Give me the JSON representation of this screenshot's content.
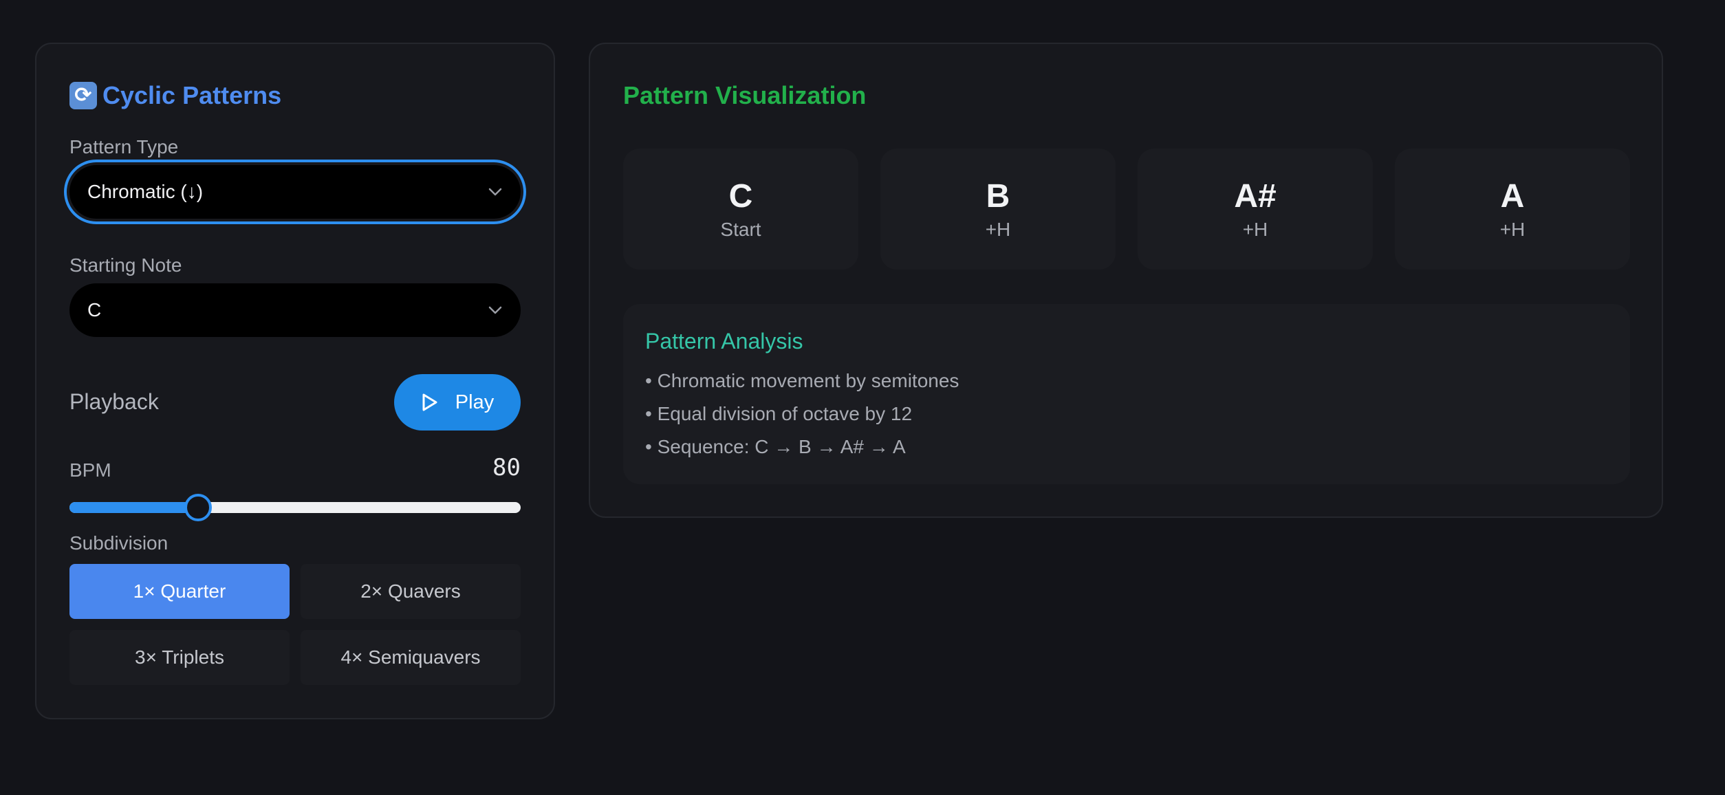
{
  "left": {
    "title": "Cyclic Patterns",
    "title_icon": "refresh-icon",
    "pattern_type": {
      "label": "Pattern Type",
      "value": "Chromatic (↓)"
    },
    "starting_note": {
      "label": "Starting Note",
      "value": "C"
    },
    "playback": {
      "label": "Playback",
      "play_label": "Play",
      "play_icon": "play-icon"
    },
    "bpm": {
      "label": "BPM",
      "value": "80",
      "fill_fraction": 0.285
    },
    "subdivision": {
      "label": "Subdivision",
      "options": [
        "1× Quarter",
        "2× Quavers",
        "3× Triplets",
        "4× Semiquavers"
      ],
      "selected": "1× Quarter"
    }
  },
  "right": {
    "title": "Pattern Visualization",
    "notes": [
      {
        "name": "C",
        "sub": "Start"
      },
      {
        "name": "B",
        "sub": "+H"
      },
      {
        "name": "A#",
        "sub": "+H"
      },
      {
        "name": "A",
        "sub": "+H"
      }
    ],
    "analysis": {
      "title": "Pattern Analysis",
      "lines": [
        "• Chromatic movement by semitones",
        "• Equal division of octave by 12",
        "• Sequence: C → B → A# → A"
      ]
    }
  },
  "colors": {
    "background": "#131419",
    "panel": "#17181d",
    "accent_blue": "#2d8ff0",
    "title_blue": "#4f8cf0",
    "title_green": "#22b04b",
    "analysis_teal": "#35c6a8"
  }
}
